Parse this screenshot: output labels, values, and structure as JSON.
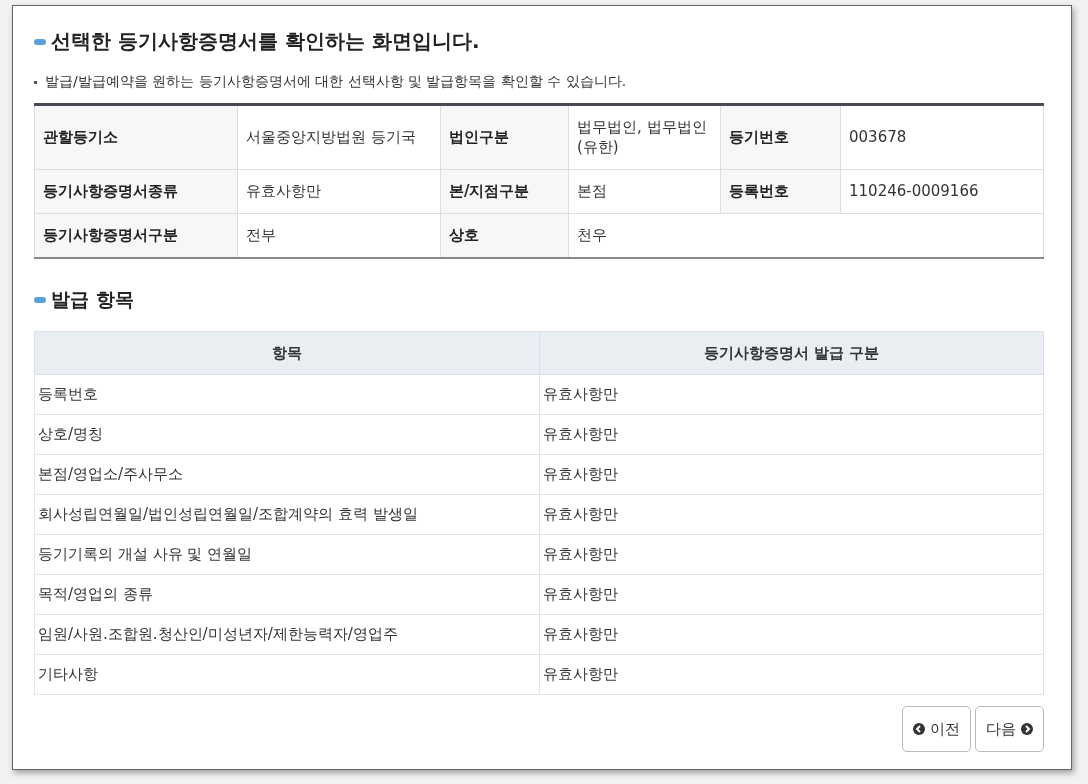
{
  "title": "선택한 등기사항증명서를 확인하는 화면입니다.",
  "description": "발급/발급예약을 원하는 등기사항증명서에 대한 선택사항 및 발급항목을 확인할 수 있습니다.",
  "info_rows": [
    [
      {
        "label": "관할등기소",
        "value": "서울중앙지방법원 등기국"
      },
      {
        "label": "법인구분",
        "value": "법무법인, 법무법인(유한)"
      },
      {
        "label": "등기번호",
        "value": "003678"
      }
    ],
    [
      {
        "label": "등기사항증명서종류",
        "value": "유효사항만"
      },
      {
        "label": "본/지점구분",
        "value": "본점"
      },
      {
        "label": "등록번호",
        "value": "110246-0009166"
      }
    ],
    [
      {
        "label": "등기사항증명서구분",
        "value": "전부"
      },
      {
        "label": "상호",
        "value": "천우"
      }
    ]
  ],
  "section_title": "발급 항목",
  "items_table": {
    "columns": [
      "항목",
      "등기사항증명서 발급 구분"
    ],
    "rows": [
      [
        "등록번호",
        "유효사항만"
      ],
      [
        "상호/명칭",
        "유효사항만"
      ],
      [
        "본점/영업소/주사무소",
        "유효사항만"
      ],
      [
        "회사성립연월일/법인성립연월일/조합계약의 효력 발생일",
        "유효사항만"
      ],
      [
        "등기기록의 개설 사유 및 연월일",
        "유효사항만"
      ],
      [
        "목적/영업의 종류",
        "유효사항만"
      ],
      [
        "임원/사원.조합원.청산인/미성년자/제한능력자/영업주",
        "유효사항만"
      ],
      [
        "기타사항",
        "유효사항만"
      ]
    ]
  },
  "buttons": [
    {
      "label": "이전",
      "kind": "prev"
    },
    {
      "label": "다음",
      "kind": "next"
    }
  ]
}
